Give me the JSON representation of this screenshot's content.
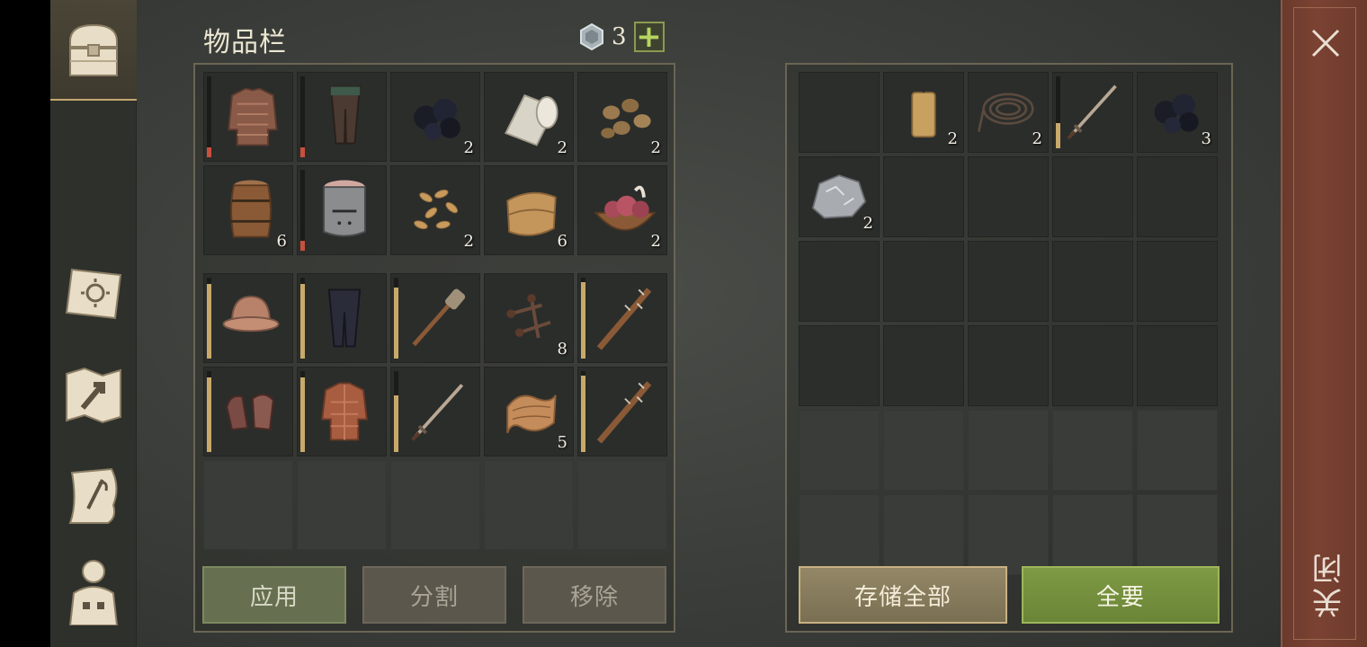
{
  "inventory": {
    "title": "物品栏",
    "gems": "3",
    "plus": "+",
    "bag": [
      {
        "icon": "chainmail-shirt-icon",
        "qty": "",
        "dur": 0.12,
        "dur_color": "#c8503c"
      },
      {
        "icon": "chainmail-leggings-icon",
        "qty": "",
        "dur": 0.12,
        "dur_color": "#c8503c"
      },
      {
        "icon": "coal-icon",
        "qty": "2"
      },
      {
        "icon": "cloth-roll-icon",
        "qty": "2"
      },
      {
        "icon": "potatoes-icon",
        "qty": "2"
      },
      {
        "icon": "barrel-icon",
        "qty": "6"
      },
      {
        "icon": "iron-helmet-icon",
        "qty": "",
        "dur": 0.12,
        "dur_color": "#c8503c"
      },
      {
        "icon": "seeds-icon",
        "qty": "2"
      },
      {
        "icon": "leather-icon",
        "qty": "6"
      },
      {
        "icon": "meat-bowl-icon",
        "qty": "2"
      }
    ],
    "equipment": [
      {
        "icon": "kettle-helmet-icon",
        "qty": "",
        "dur": 0.92,
        "dur_color": "#c9a96a"
      },
      {
        "icon": "padded-pants-icon",
        "qty": "",
        "dur": 0.92,
        "dur_color": "#c9a96a"
      },
      {
        "icon": "mace-icon",
        "qty": "",
        "dur": 0.88,
        "dur_color": "#c9a96a"
      },
      {
        "icon": "nails-icon",
        "qty": "8"
      },
      {
        "icon": "spiked-club-icon",
        "qty": "",
        "dur": 0.94,
        "dur_color": "#c9a96a"
      },
      {
        "icon": "chainmail-gloves-icon",
        "qty": "",
        "dur": 0.92,
        "dur_color": "#c9a96a"
      },
      {
        "icon": "padded-jacket-icon",
        "qty": "",
        "dur": 0.92,
        "dur_color": "#c9a96a"
      },
      {
        "icon": "sword-icon",
        "qty": "",
        "dur": 0.7,
        "dur_color": "#c9a96a"
      },
      {
        "icon": "rags-icon",
        "qty": "5"
      },
      {
        "icon": "spiked-club-icon",
        "qty": "",
        "dur": 0.94,
        "dur_color": "#c9a96a"
      }
    ],
    "buttons": {
      "apply": "应用",
      "split": "分割",
      "remove": "移除"
    }
  },
  "storage": {
    "items": [
      {
        "icon": "",
        "qty": ""
      },
      {
        "icon": "candle-icon",
        "qty": "2"
      },
      {
        "icon": "rope-icon",
        "qty": "2"
      },
      {
        "icon": "sword-icon",
        "qty": "",
        "dur": 0.35,
        "dur_color": "#c9a96a"
      },
      {
        "icon": "coal-icon",
        "qty": "3"
      },
      {
        "icon": "silver-ore-icon",
        "qty": "2"
      }
    ],
    "buttons": {
      "store_all": "存储全部",
      "take_all": "全要"
    }
  },
  "close_label": "关闭"
}
